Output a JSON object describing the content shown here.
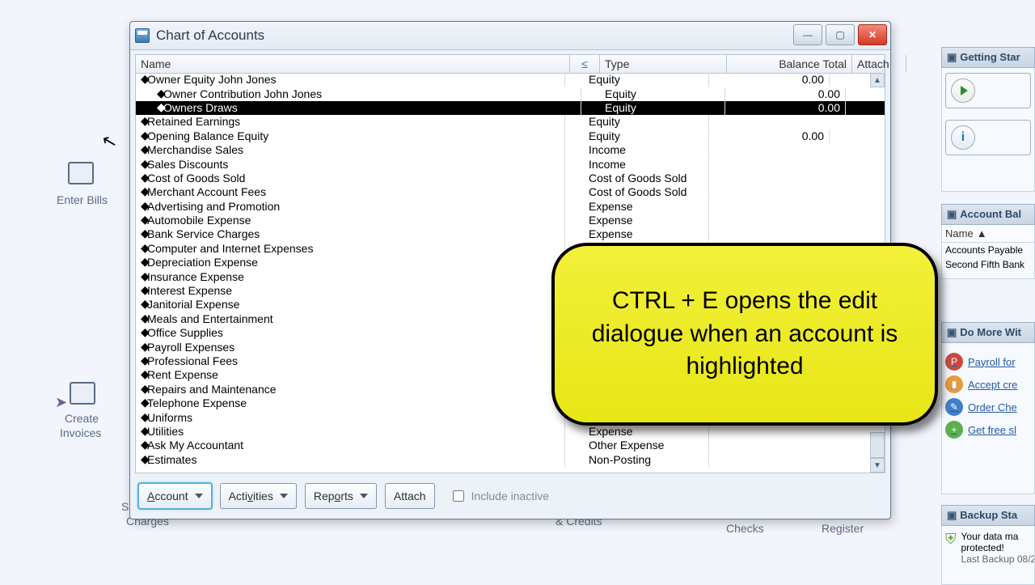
{
  "bg": {
    "enter_bills": "Enter Bills",
    "create_invoices_l1": "Create",
    "create_invoices_l2": "Invoices",
    "s": "S",
    "charges": "Charges",
    "checks": "Checks",
    "register": "Register",
    "credits": "& Credits"
  },
  "window": {
    "title": "Chart of Accounts",
    "columns": {
      "name": "Name",
      "s": "≤",
      "type": "Type",
      "balance": "Balance Total",
      "attach": "Attach"
    },
    "rows": [
      {
        "name": "Owner Equity John Jones",
        "indent": 0,
        "type": "Equity",
        "balance": "0.00",
        "sel": false
      },
      {
        "name": "Owner Contribution John Jones",
        "indent": 1,
        "type": "Equity",
        "balance": "0.00",
        "sel": false
      },
      {
        "name": "Owners Draws",
        "indent": 1,
        "type": "Equity",
        "balance": "0.00",
        "sel": true
      },
      {
        "name": "Retained Earnings",
        "indent": 0,
        "type": "Equity",
        "balance": "",
        "sel": false
      },
      {
        "name": "Opening Balance Equity",
        "indent": 0,
        "type": "Equity",
        "balance": "0.00",
        "sel": false
      },
      {
        "name": "Merchandise Sales",
        "indent": 0,
        "type": "Income",
        "balance": "",
        "sel": false
      },
      {
        "name": "Sales Discounts",
        "indent": 0,
        "type": "Income",
        "balance": "",
        "sel": false
      },
      {
        "name": "Cost of Goods Sold",
        "indent": 0,
        "type": "Cost of Goods Sold",
        "balance": "",
        "sel": false
      },
      {
        "name": "Merchant Account Fees",
        "indent": 0,
        "type": "Cost of Goods Sold",
        "balance": "",
        "sel": false
      },
      {
        "name": "Advertising and Promotion",
        "indent": 0,
        "type": "Expense",
        "balance": "",
        "sel": false
      },
      {
        "name": "Automobile Expense",
        "indent": 0,
        "type": "Expense",
        "balance": "",
        "sel": false
      },
      {
        "name": "Bank Service Charges",
        "indent": 0,
        "type": "Expense",
        "balance": "",
        "sel": false
      },
      {
        "name": "Computer and Internet Expenses",
        "indent": 0,
        "type": "Expense",
        "balance": "",
        "sel": false
      },
      {
        "name": "Depreciation Expense",
        "indent": 0,
        "type": "",
        "balance": "",
        "sel": false
      },
      {
        "name": "Insurance Expense",
        "indent": 0,
        "type": "",
        "balance": "",
        "sel": false
      },
      {
        "name": "Interest Expense",
        "indent": 0,
        "type": "",
        "balance": "",
        "sel": false
      },
      {
        "name": "Janitorial Expense",
        "indent": 0,
        "type": "",
        "balance": "",
        "sel": false
      },
      {
        "name": "Meals and Entertainment",
        "indent": 0,
        "type": "",
        "balance": "",
        "sel": false
      },
      {
        "name": "Office Supplies",
        "indent": 0,
        "type": "",
        "balance": "",
        "sel": false
      },
      {
        "name": "Payroll Expenses",
        "indent": 0,
        "type": "",
        "balance": "",
        "sel": false
      },
      {
        "name": "Professional Fees",
        "indent": 0,
        "type": "",
        "balance": "",
        "sel": false
      },
      {
        "name": "Rent Expense",
        "indent": 0,
        "type": "",
        "balance": "",
        "sel": false
      },
      {
        "name": "Repairs and Maintenance",
        "indent": 0,
        "type": "",
        "balance": "",
        "sel": false
      },
      {
        "name": "Telephone Expense",
        "indent": 0,
        "type": "",
        "balance": "",
        "sel": false
      },
      {
        "name": "Uniforms",
        "indent": 0,
        "type": "",
        "balance": "",
        "sel": false
      },
      {
        "name": "Utilities",
        "indent": 0,
        "type": "Expense",
        "balance": "",
        "sel": false
      },
      {
        "name": "Ask My Accountant",
        "indent": 0,
        "type": "Other Expense",
        "balance": "",
        "sel": false
      },
      {
        "name": "Estimates",
        "indent": 0,
        "type": "Non-Posting",
        "balance": "",
        "sel": false
      }
    ],
    "footer": {
      "account": "Account",
      "activities": "Activities",
      "reports": "Reports",
      "attach": "Attach",
      "include_inactive": "Include inactive"
    }
  },
  "right": {
    "getting_started": "Getting Star",
    "account_bal": "Account Bal",
    "ab_col": "Name",
    "ab_row1": "Accounts Payable",
    "ab_row2": "Second Fifth Bank",
    "do_more": "Do More Wit",
    "links": {
      "payroll": "Payroll for",
      "accept": "Accept cre",
      "order": "Order Che",
      "free": "Get free sl"
    },
    "backup": "Backup Sta",
    "backup_l1": "Your data ma",
    "backup_l2": "protected!",
    "backup_l3": "Last Backup 08/2"
  },
  "callout": "CTRL + E opens the edit dialogue when an account is highlighted"
}
